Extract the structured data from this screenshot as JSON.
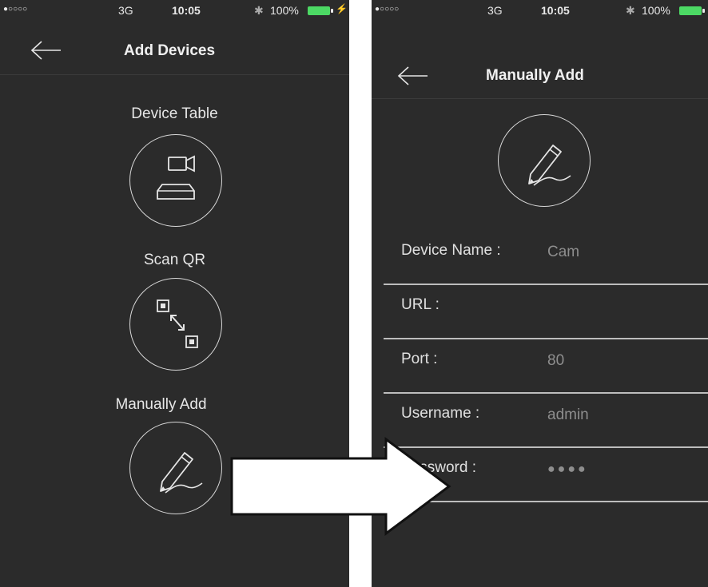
{
  "left_screen": {
    "status": {
      "signal": "●○○○○",
      "network": "3G",
      "time": "10:05",
      "bluetooth": "✱",
      "battery": "100%",
      "charging": "⚡"
    },
    "header": {
      "title": "Add Devices",
      "back_icon": "back-arrow-icon"
    },
    "options": [
      {
        "label": "Device Table",
        "icon": "camera-nvr-icon"
      },
      {
        "label": "Scan QR",
        "icon": "qr-scan-icon"
      },
      {
        "label": "Manually Add",
        "icon": "pencil-icon"
      }
    ]
  },
  "right_screen": {
    "status": {
      "signal": "●○○○○",
      "network": "3G",
      "time": "10:05",
      "bluetooth": "✱",
      "battery": "100%"
    },
    "header": {
      "title": "Manually Add",
      "back_icon": "back-arrow-icon"
    },
    "hero_icon": "pencil-icon",
    "form": [
      {
        "label": "Device Name :",
        "value": "Cam"
      },
      {
        "label": "URL :",
        "value": ""
      },
      {
        "label": "Port :",
        "value": "80"
      },
      {
        "label": "Username :",
        "value": "admin"
      },
      {
        "label": "Password :",
        "value": "●●●●"
      }
    ]
  },
  "annotation": {
    "arrow": "right-arrow-overlay"
  },
  "colors": {
    "screen_bg": "#2b2b2b",
    "text": "#e6e6e6",
    "value_text": "#8e8e8e",
    "battery": "#4cd964"
  }
}
